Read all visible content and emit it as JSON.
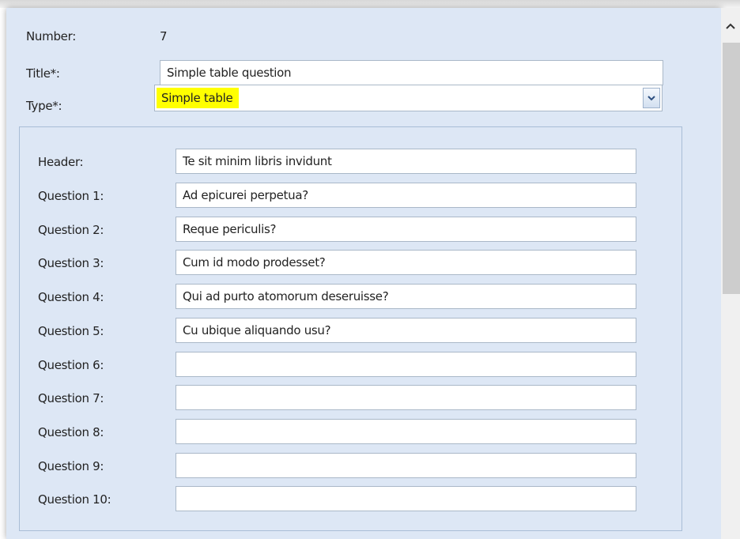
{
  "form": {
    "number_label": "Number:",
    "number_value": "7",
    "title_label": "Title*:",
    "title_value": "Simple table question",
    "type_label": "Type*:",
    "type_value": "Simple table",
    "type_highlight_color": "#ffff00"
  },
  "table": {
    "header_label": "Header:",
    "header_value": "Te sit minim libris invidunt",
    "questions": [
      {
        "label": "Question 1:",
        "value": "Ad epicurei perpetua?"
      },
      {
        "label": "Question 2:",
        "value": "Reque periculis?"
      },
      {
        "label": "Question 3:",
        "value": "Cum id modo prodesset?"
      },
      {
        "label": "Question 4:",
        "value": "Qui ad purto atomorum deseruisse?"
      },
      {
        "label": "Question 5:",
        "value": "Cu ubique aliquando usu?"
      },
      {
        "label": "Question 6:",
        "value": ""
      },
      {
        "label": "Question 7:",
        "value": ""
      },
      {
        "label": "Question 8:",
        "value": ""
      },
      {
        "label": "Question 9:",
        "value": ""
      },
      {
        "label": "Question 10:",
        "value": ""
      }
    ]
  },
  "icons": {
    "dropdown": "chevron-down-icon",
    "scroll_up": "chevron-up-icon"
  },
  "colors": {
    "panel_background": "#dde7f5",
    "field_border": "#aab8c8"
  }
}
